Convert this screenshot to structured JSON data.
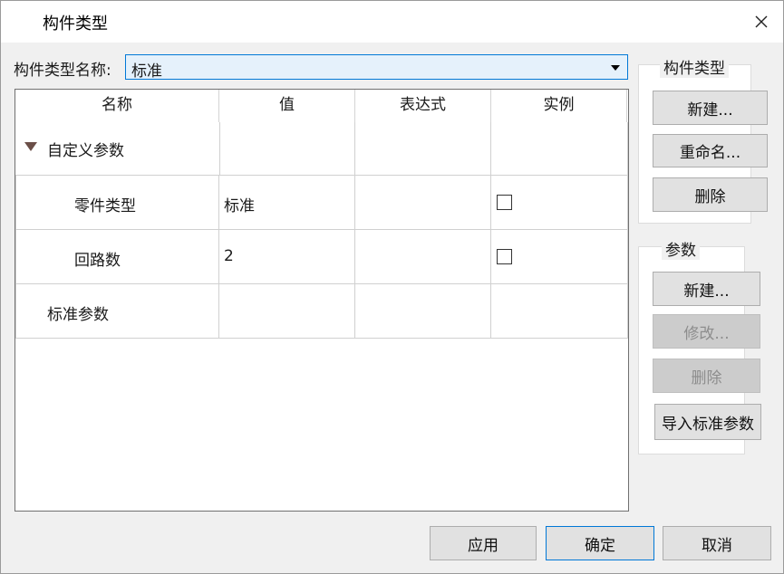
{
  "window": {
    "title": "构件类型"
  },
  "type_name": {
    "label": "构件类型名称:",
    "value": "标准"
  },
  "grid": {
    "columns": [
      "名称",
      "值",
      "表达式",
      "实例"
    ],
    "rows": [
      {
        "name": "自定义参数",
        "value": "",
        "expression": "",
        "group": true
      },
      {
        "name": "零件类型",
        "value": "标准",
        "expression": "",
        "instance": false
      },
      {
        "name": "回路数",
        "value": "2",
        "expression": "",
        "instance": false
      },
      {
        "name": "标准参数",
        "value": "",
        "expression": "",
        "group": true
      }
    ]
  },
  "type_group": {
    "title": "构件类型",
    "new": "新建...",
    "rename": "重命名...",
    "delete": "删除"
  },
  "param_group": {
    "title": "参数",
    "new": "新建...",
    "modify": "修改...",
    "delete": "删除",
    "import": "导入标准参数"
  },
  "footer": {
    "apply": "应用",
    "ok": "确定",
    "cancel": "取消"
  }
}
